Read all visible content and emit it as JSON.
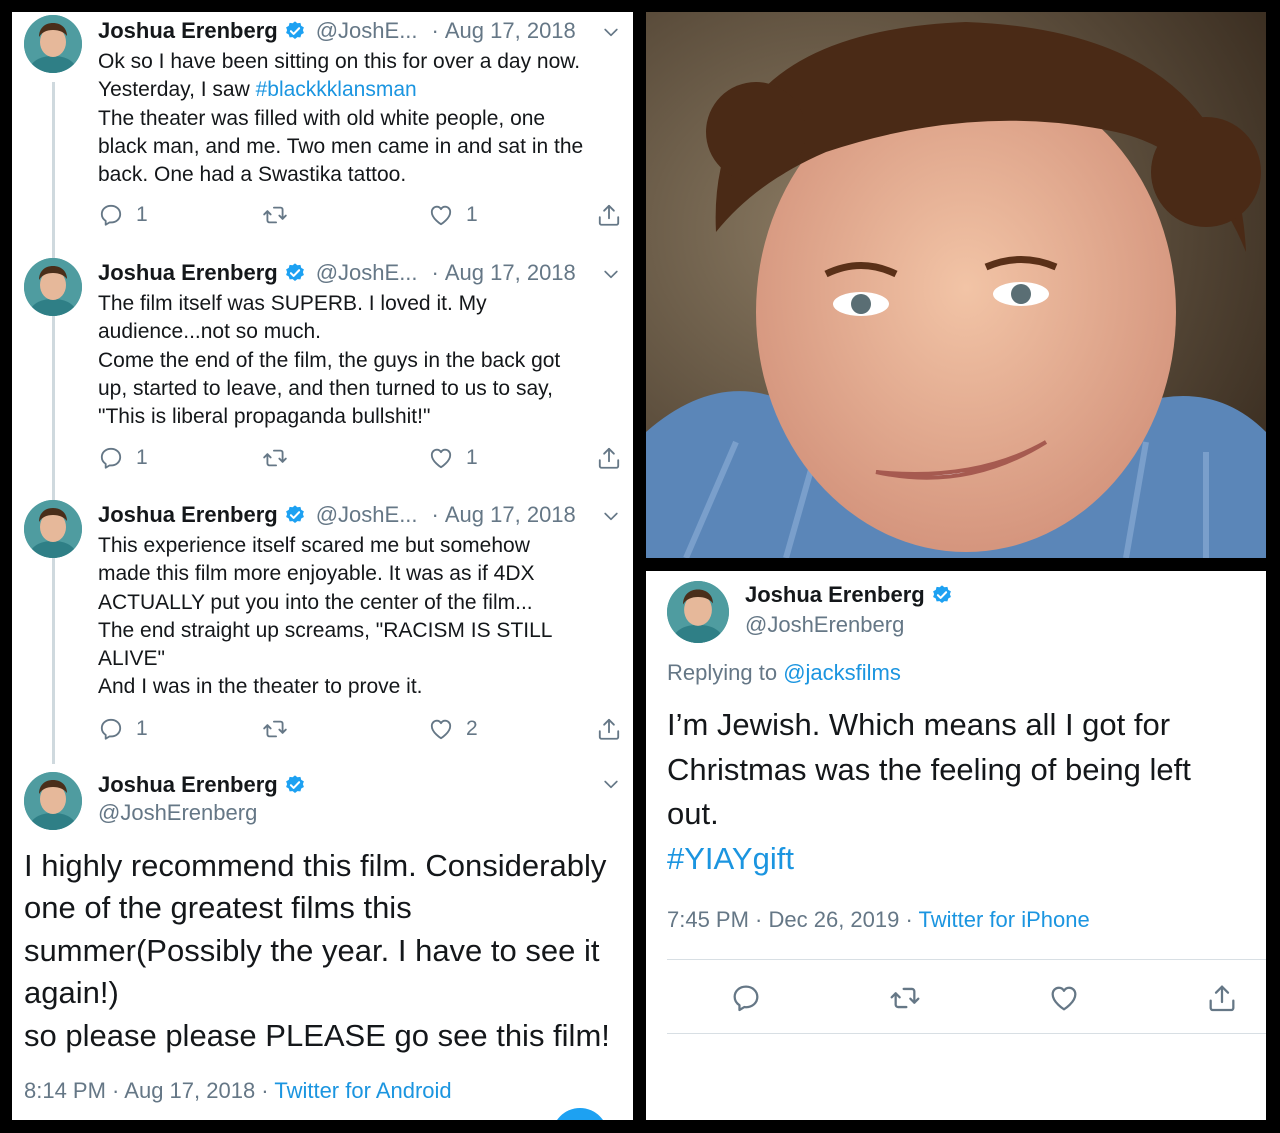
{
  "colors": {
    "link": "#1b95e0",
    "muted": "#657786",
    "text": "#14171a",
    "verified": "#1da1f2"
  },
  "thread": [
    {
      "name": "Joshua Erenberg",
      "handle": "@JoshE...",
      "date": "Aug 17, 2018",
      "lines": [
        "Ok so I have been sitting on this for over a day now.",
        "Yesterday, I saw ",
        "The theater was filled with old white people, one",
        "black man, and me. Two men came in and sat in the",
        "back. One had a Swastika tattoo."
      ],
      "hashtag": "#blackkklansman",
      "replies": "1",
      "likes": "1"
    },
    {
      "name": "Joshua Erenberg",
      "handle": "@JoshE...",
      "date": "Aug 17, 2018",
      "lines": [
        "The film itself was SUPERB. I loved it. My",
        "audience...not so much.",
        "Come the end of the film, the guys in the back got",
        "up, started to leave, and then turned to us to say,",
        "\"This is liberal propaganda bullshit!\""
      ],
      "replies": "1",
      "likes": "1"
    },
    {
      "name": "Joshua Erenberg",
      "handle": "@JoshE...",
      "date": "Aug 17, 2018",
      "lines": [
        "This experience itself scared me but somehow",
        "made this film more enjoyable. It was as if 4DX",
        "ACTUALLY put you into the center of the film...",
        "The end straight up screams, \"RACISM IS STILL",
        "ALIVE\"",
        "And I was in the theater to prove it."
      ],
      "replies": "1",
      "likes": "2"
    }
  ],
  "main_tweet": {
    "name": "Joshua Erenberg",
    "handle": "@JoshErenberg",
    "lines": [
      "I highly recommend this film. Considerably",
      "one of the greatest films this",
      "summer(Possibly the year. I have to see it",
      "again!)",
      "so please please PLEASE go see this film!"
    ],
    "time": "8:14 PM",
    "date": "Aug 17, 2018",
    "source": "Twitter for Android"
  },
  "reply_tweet": {
    "name": "Joshua Erenberg",
    "handle": "@JoshErenberg",
    "replying_label": "Replying to ",
    "replying_to": "@jacksfilms",
    "lines": [
      "I’m Jewish. Which means all I got for",
      "Christmas was the feeling of being left",
      "out."
    ],
    "hashtag": "#YIAYgift",
    "time": "7:45 PM",
    "date": "Dec 26, 2019",
    "source": "Twitter for iPhone"
  },
  "separator": " · "
}
